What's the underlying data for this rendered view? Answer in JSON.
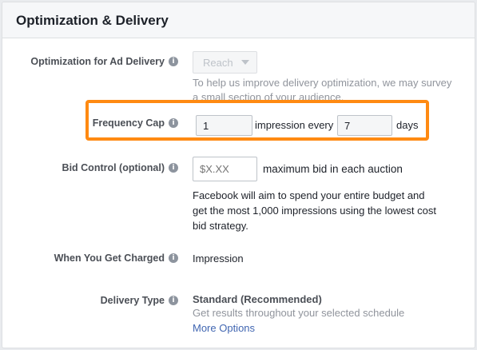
{
  "panel": {
    "title": "Optimization & Delivery"
  },
  "optimization": {
    "label": "Optimization for Ad Delivery",
    "dropdown_value": "Reach",
    "help_line1": "To help us improve delivery optimization, we may survey",
    "help_line2": "a small section of your audience."
  },
  "frequency_cap": {
    "label": "Frequency Cap",
    "impressions_value": "1",
    "impression_every_text": "impression every",
    "days_value": "7",
    "days_text": "days",
    "highlight_color": "#ff8a12"
  },
  "bid_control": {
    "label": "Bid Control (optional)",
    "placeholder": "$X.XX",
    "suffix": "maximum bid in each auction",
    "description_line1": "Facebook will aim to spend your entire budget and",
    "description_line2": "get the most 1,000 impressions using the lowest cost",
    "description_line3": "bid strategy."
  },
  "charged": {
    "label": "When You Get Charged",
    "value": "Impression"
  },
  "delivery_type": {
    "label": "Delivery Type",
    "value": "Standard (Recommended)",
    "description": "Get results throughout your selected schedule",
    "more_options_label": "More Options"
  },
  "icons": {
    "info": "info-icon",
    "caret": "chevron-down-icon"
  },
  "colors": {
    "link": "#4267b2",
    "help_text": "#90949c",
    "label": "#4b4f56"
  }
}
